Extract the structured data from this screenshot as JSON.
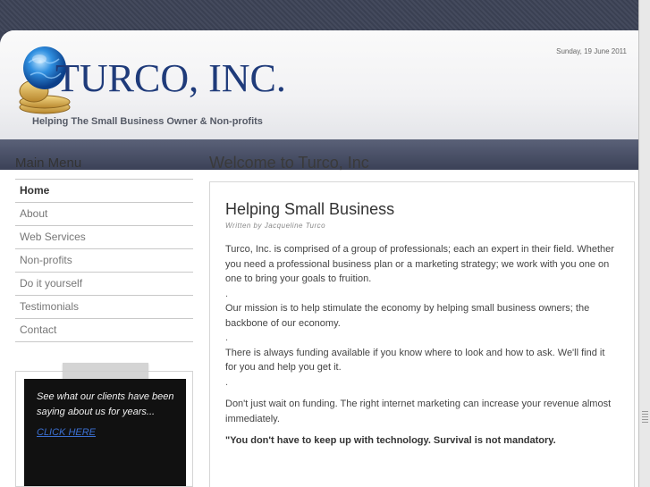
{
  "header": {
    "logo_text": "TURCO, INC.",
    "tagline": "Helping The Small Business Owner & Non-profits",
    "date": "Sunday, 19 June 2011"
  },
  "sidebar": {
    "title": "Main Menu",
    "items": [
      {
        "label": "Home"
      },
      {
        "label": "About"
      },
      {
        "label": "Web Services"
      },
      {
        "label": "Non-profits"
      },
      {
        "label": "Do it yourself"
      },
      {
        "label": "Testimonials"
      },
      {
        "label": "Contact"
      }
    ],
    "testimonial": {
      "text": "See what our clients have been saying about us for years...",
      "link": "CLICK HERE"
    }
  },
  "main": {
    "title": "Welcome to Turco, Inc",
    "article": {
      "heading": "Helping Small Business",
      "byline": "Written by Jacqueline Turco",
      "paragraphs": [
        "Turco, Inc. is comprised of a group of professionals; each an expert in their field. Whether you need a professional business plan or a marketing strategy; we work with you one on one to bring your goals to fruition.",
        "Our mission is to help stimulate the economy by helping small business owners; the backbone of our economy.",
        "There is always funding available if you know where to look and how to ask. We'll find it for you and help you get it.",
        "Don't just wait on funding. The right internet marketing can increase your revenue almost immediately."
      ],
      "separator": ".",
      "quote": "\"You don't have to keep up with technology. Survival is not mandatory."
    }
  },
  "colors": {
    "logo_blue": "#1f3b7a",
    "nav_dark": "#3b4157",
    "link_blue": "#3b6fd1"
  }
}
